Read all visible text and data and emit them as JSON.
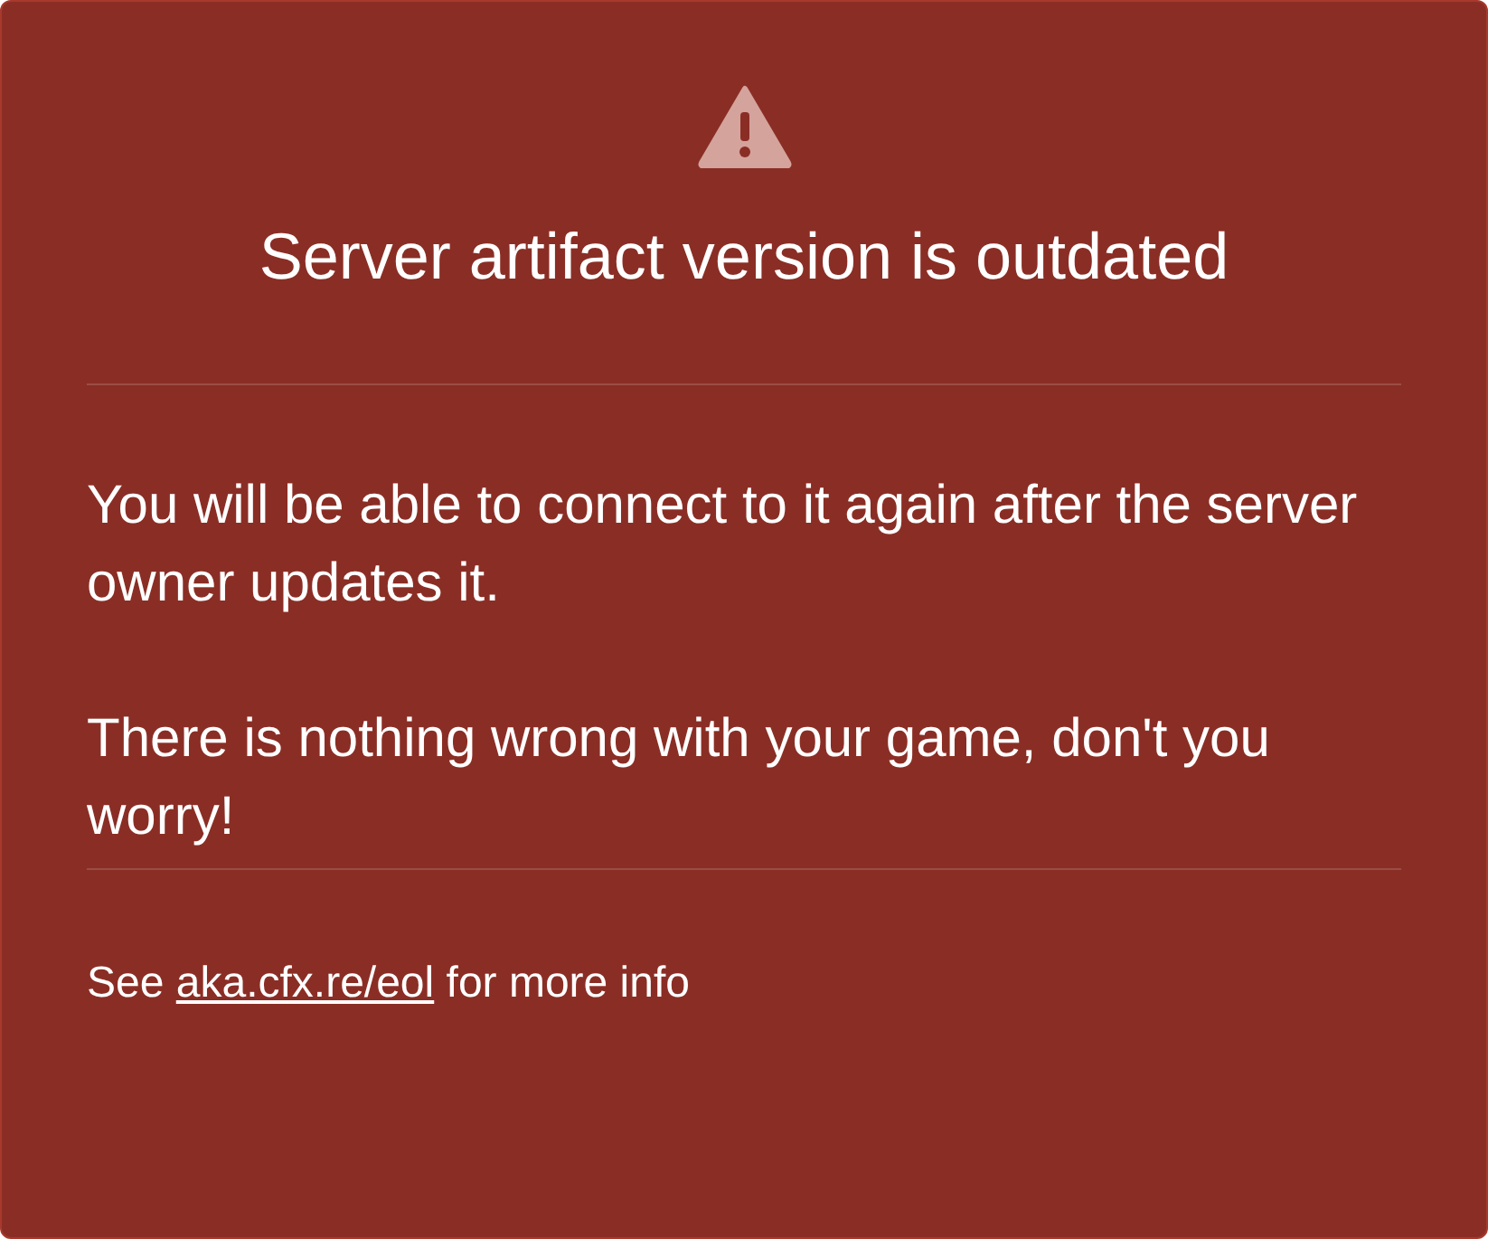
{
  "dialog": {
    "title": "Server artifact version is outdated",
    "paragraphs": [
      "You will be able to connect to it again after the server owner updates it.",
      "There is nothing wrong with your game, don't you worry!"
    ],
    "footer": {
      "before": "See",
      "link": "aka.cfx.re/eol",
      "after": "for more info"
    }
  }
}
